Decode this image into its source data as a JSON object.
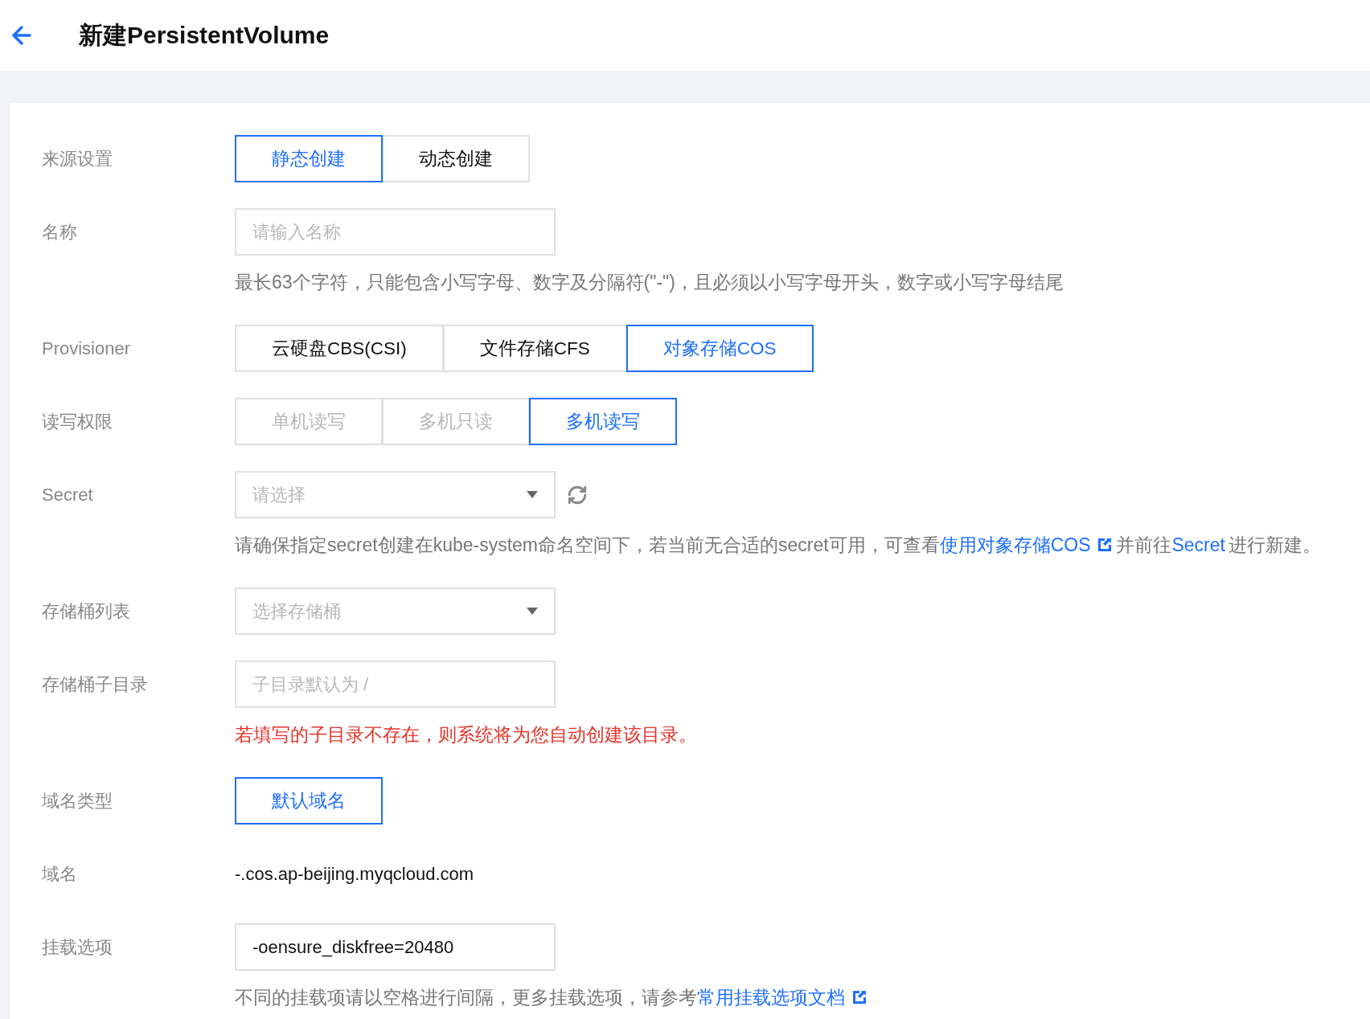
{
  "header": {
    "title": "新建PersistentVolume"
  },
  "rows": [
    {
      "label": "来源设置",
      "kind": "segmented",
      "options": [
        {
          "label": "静态创建",
          "selected": true,
          "disabled": false
        },
        {
          "label": "动态创建",
          "selected": false,
          "disabled": false
        }
      ]
    },
    {
      "label": "名称",
      "kind": "input",
      "placeholder": "请输入名称",
      "hint": {
        "error": false,
        "parts": [
          {
            "kind": "text",
            "text": "最长63个字符，只能包含小写字母、数字及分隔符(\"-\")，且必须以小写字母开头，数字或小写字母结尾"
          }
        ]
      }
    },
    {
      "label": "Provisioner",
      "kind": "segmented",
      "options": [
        {
          "label": "云硬盘CBS(CSI)",
          "selected": false,
          "disabled": false
        },
        {
          "label": "文件存储CFS",
          "selected": false,
          "disabled": false
        },
        {
          "label": "对象存储COS",
          "selected": true,
          "disabled": false
        }
      ]
    },
    {
      "label": "读写权限",
      "kind": "segmented",
      "options": [
        {
          "label": "单机读写",
          "selected": false,
          "disabled": true
        },
        {
          "label": "多机只读",
          "selected": false,
          "disabled": true
        },
        {
          "label": "多机读写",
          "selected": true,
          "disabled": false
        }
      ]
    },
    {
      "label": "Secret",
      "kind": "select",
      "placeholder": "请选择",
      "refresh": true,
      "hint": {
        "error": false,
        "parts": [
          {
            "kind": "text",
            "text": "请确保指定secret创建在kube-system命名空间下，若当前无合适的secret可用，可查看"
          },
          {
            "kind": "link",
            "text": "使用对象存储COS",
            "external": true
          },
          {
            "kind": "text",
            "text": "并前往"
          },
          {
            "kind": "link",
            "text": "Secret",
            "external": false
          },
          {
            "kind": "text",
            "text": "进行新建。"
          }
        ]
      }
    },
    {
      "label": "存储桶列表",
      "kind": "select",
      "placeholder": "选择存储桶",
      "refresh": false
    },
    {
      "label": "存储桶子目录",
      "kind": "input",
      "placeholder": "子目录默认为 /",
      "hint": {
        "error": true,
        "parts": [
          {
            "kind": "text",
            "text": "若填写的子目录不存在，则系统将为您自动创建该目录。"
          }
        ]
      }
    },
    {
      "label": "域名类型",
      "kind": "segmented",
      "options": [
        {
          "label": "默认域名",
          "selected": true,
          "disabled": false
        }
      ]
    },
    {
      "label": "域名",
      "kind": "text",
      "value": "-.cos.ap-beijing.myqcloud.com"
    },
    {
      "label": "挂载选项",
      "kind": "input",
      "value": "-oensure_diskfree=20480",
      "hint": {
        "error": false,
        "parts": [
          {
            "kind": "text",
            "text": "不同的挂载项请以空格进行间隔，更多挂载选项，请参考"
          },
          {
            "kind": "link",
            "text": "常用挂载选项文档",
            "external": true
          }
        ]
      }
    }
  ]
}
